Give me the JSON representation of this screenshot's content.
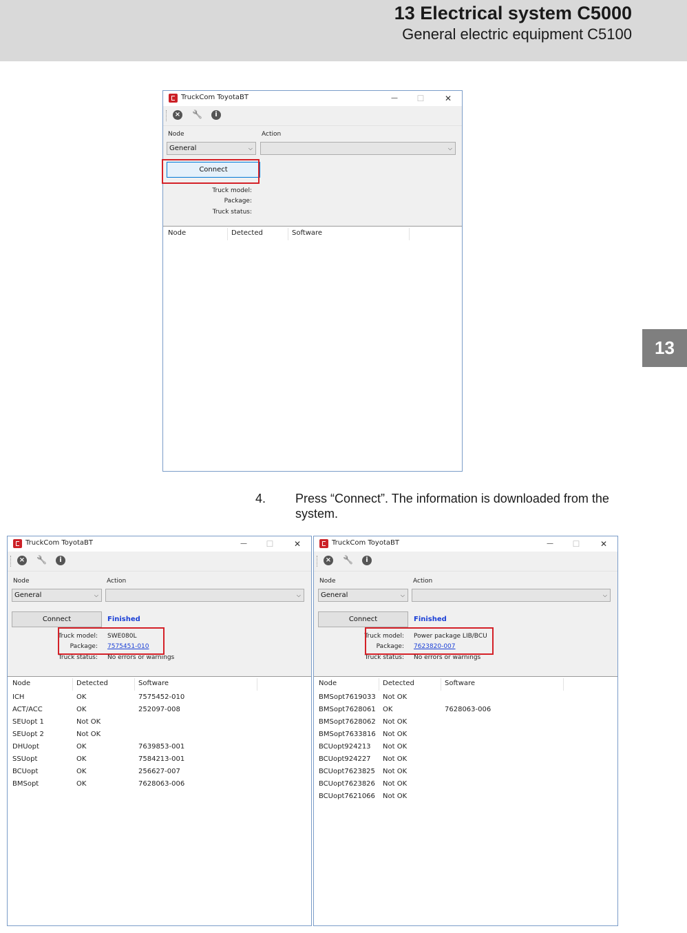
{
  "header": {
    "chapter_title": "13 Electrical system C5000",
    "section_title": "General electric equipment C5100"
  },
  "chapter_tab": "13",
  "step": {
    "number": "4.",
    "text": "Press “Connect”. The information is downloaded from the system."
  },
  "colors": {
    "highlight_box": "#d42027",
    "link": "#1a3fd6",
    "header_band": "#d9d9d9",
    "chapter_tab": "#7f7f7f"
  },
  "windows": [
    {
      "title": "TruckCom ToyotaBT",
      "node_label": "Node",
      "action_label": "Action",
      "node_value": "General",
      "action_value": "",
      "connect_label": "Connect",
      "status": "",
      "info": {
        "truck_model_label": "Truck model:",
        "truck_model": "",
        "package_label": "Package:",
        "package": "",
        "truck_status_label": "Truck status:",
        "truck_status": ""
      },
      "columns": [
        "Node",
        "Detected",
        "Software"
      ],
      "rows": []
    },
    {
      "title": "TruckCom ToyotaBT",
      "node_label": "Node",
      "action_label": "Action",
      "node_value": "General",
      "action_value": "",
      "connect_label": "Connect",
      "status": "Finished",
      "info": {
        "truck_model_label": "Truck model:",
        "truck_model": "SWE080L",
        "package_label": "Package:",
        "package": "7575451-010",
        "truck_status_label": "Truck status:",
        "truck_status": "No errors or warnings"
      },
      "columns": [
        "Node",
        "Detected",
        "Software"
      ],
      "rows": [
        [
          "ICH",
          "OK",
          "7575452-010"
        ],
        [
          "ACT/ACC",
          "OK",
          "252097-008"
        ],
        [
          "SEUopt 1",
          "Not OK",
          ""
        ],
        [
          "SEUopt 2",
          "Not OK",
          ""
        ],
        [
          "DHUopt",
          "OK",
          "7639853-001"
        ],
        [
          "SSUopt",
          "OK",
          "7584213-001"
        ],
        [
          "BCUopt",
          "OK",
          "256627-007"
        ],
        [
          "BMSopt",
          "OK",
          "7628063-006"
        ]
      ]
    },
    {
      "title": "TruckCom ToyotaBT",
      "node_label": "Node",
      "action_label": "Action",
      "node_value": "General",
      "action_value": "",
      "connect_label": "Connect",
      "status": "Finished",
      "info": {
        "truck_model_label": "Truck model:",
        "truck_model": "Power package LIB/BCU",
        "package_label": "Package:",
        "package": "7623820-007",
        "truck_status_label": "Truck status:",
        "truck_status": "No errors or warnings"
      },
      "columns": [
        "Node",
        "Detected",
        "Software"
      ],
      "rows": [
        [
          "BMSopt7619033",
          "Not OK",
          ""
        ],
        [
          "BMSopt7628061",
          "OK",
          "7628063-006"
        ],
        [
          "BMSopt7628062",
          "Not OK",
          ""
        ],
        [
          "BMSopt7633816",
          "Not OK",
          ""
        ],
        [
          "BCUopt924213",
          "Not OK",
          ""
        ],
        [
          "BCUopt924227",
          "Not OK",
          ""
        ],
        [
          "BCUopt7623825",
          "Not OK",
          ""
        ],
        [
          "BCUopt7623826",
          "Not OK",
          ""
        ],
        [
          "BCUopt7621066",
          "Not OK",
          ""
        ]
      ]
    }
  ]
}
